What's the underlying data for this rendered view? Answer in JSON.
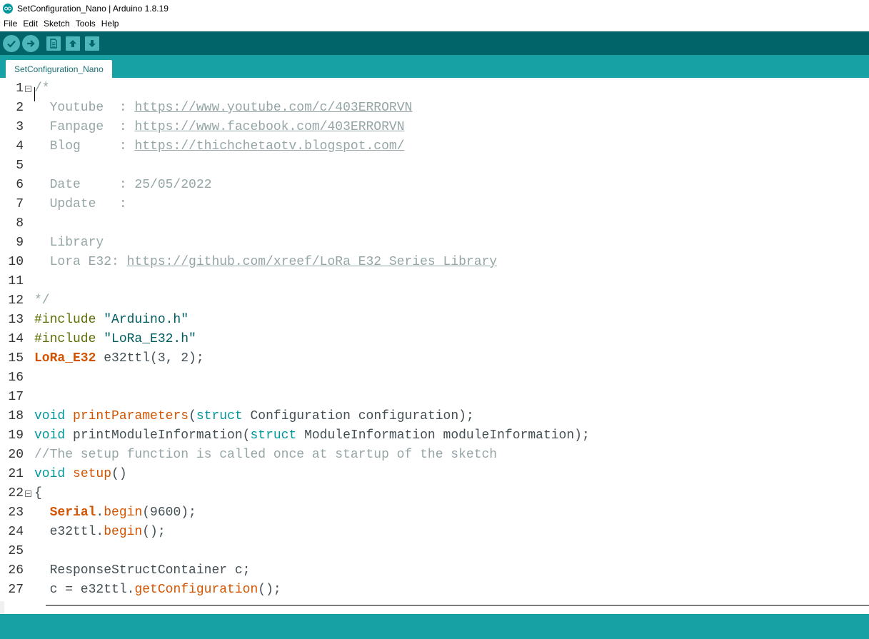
{
  "window": {
    "title": "SetConfiguration_Nano | Arduino 1.8.19"
  },
  "menu": [
    "File",
    "Edit",
    "Sketch",
    "Tools",
    "Help"
  ],
  "toolbar": {
    "verify": "verify-icon",
    "upload": "upload-icon",
    "new": "new-icon",
    "open": "open-icon",
    "save": "save-icon"
  },
  "tab": {
    "label": "SetConfiguration_Nano"
  },
  "colors": {
    "toolbar": "#006468",
    "tabstrip": "#17a1a5",
    "comment": "#95a5a6",
    "keyword_type": "#00979c",
    "function": "#d35400",
    "preprocessor": "#5e6d03"
  },
  "lines": [
    {
      "n": "1",
      "fold": true,
      "tokens": [
        [
          "comment",
          "/*"
        ]
      ]
    },
    {
      "n": "2",
      "tokens": [
        [
          "comment",
          "  Youtube  : "
        ],
        [
          "url",
          "https://www.youtube.com/c/403ERRORVN"
        ]
      ]
    },
    {
      "n": "3",
      "tokens": [
        [
          "comment",
          "  Fanpage  : "
        ],
        [
          "url",
          "https://www.facebook.com/403ERRORVN"
        ]
      ]
    },
    {
      "n": "4",
      "tokens": [
        [
          "comment",
          "  Blog     : "
        ],
        [
          "url",
          "https://thichchetaotv.blogspot.com/"
        ]
      ]
    },
    {
      "n": "5",
      "tokens": []
    },
    {
      "n": "6",
      "tokens": [
        [
          "comment",
          "  Date     : 25/05/2022"
        ]
      ]
    },
    {
      "n": "7",
      "tokens": [
        [
          "comment",
          "  Update   :"
        ]
      ]
    },
    {
      "n": "8",
      "tokens": []
    },
    {
      "n": "9",
      "tokens": [
        [
          "comment",
          "  Library"
        ]
      ]
    },
    {
      "n": "10",
      "tokens": [
        [
          "comment",
          "  Lora E32: "
        ],
        [
          "url",
          "https://github.com/xreef/LoRa_E32_Series_Library"
        ]
      ]
    },
    {
      "n": "11",
      "tokens": []
    },
    {
      "n": "12",
      "tokens": [
        [
          "comment",
          "*/"
        ]
      ]
    },
    {
      "n": "13",
      "tokens": [
        [
          "pre",
          "#include "
        ],
        [
          "str",
          "\"Arduino.h\""
        ]
      ]
    },
    {
      "n": "14",
      "tokens": [
        [
          "pre",
          "#include "
        ],
        [
          "str",
          "\"LoRa_E32.h\""
        ]
      ]
    },
    {
      "n": "15",
      "tokens": [
        [
          "cls",
          "LoRa_E32"
        ],
        [
          "plain",
          " e32ttl(3, 2);"
        ]
      ]
    },
    {
      "n": "16",
      "tokens": []
    },
    {
      "n": "17",
      "tokens": []
    },
    {
      "n": "18",
      "tokens": [
        [
          "type",
          "void"
        ],
        [
          "plain",
          " "
        ],
        [
          "fn",
          "printParameters"
        ],
        [
          "plain",
          "("
        ],
        [
          "type",
          "struct"
        ],
        [
          "plain",
          " Configuration configuration);"
        ]
      ]
    },
    {
      "n": "19",
      "tokens": [
        [
          "type",
          "void"
        ],
        [
          "plain",
          " printModuleInformation("
        ],
        [
          "type",
          "struct"
        ],
        [
          "plain",
          " ModuleInformation moduleInformation);"
        ]
      ]
    },
    {
      "n": "20",
      "tokens": [
        [
          "comment",
          "//The setup function is called once at startup of the sketch"
        ]
      ]
    },
    {
      "n": "21",
      "tokens": [
        [
          "type",
          "void"
        ],
        [
          "plain",
          " "
        ],
        [
          "fn",
          "setup"
        ],
        [
          "plain",
          "()"
        ]
      ]
    },
    {
      "n": "22",
      "fold": true,
      "tokens": [
        [
          "plain",
          "{"
        ]
      ]
    },
    {
      "n": "23",
      "tokens": [
        [
          "plain",
          "  "
        ],
        [
          "cls",
          "Serial"
        ],
        [
          "plain",
          "."
        ],
        [
          "fn",
          "begin"
        ],
        [
          "plain",
          "(9600);"
        ]
      ]
    },
    {
      "n": "24",
      "tokens": [
        [
          "plain",
          "  e32ttl."
        ],
        [
          "fn",
          "begin"
        ],
        [
          "plain",
          "();"
        ]
      ]
    },
    {
      "n": "25",
      "tokens": []
    },
    {
      "n": "26",
      "tokens": [
        [
          "plain",
          "  ResponseStructContainer c;"
        ]
      ]
    },
    {
      "n": "27",
      "tokens": [
        [
          "plain",
          "  c = e32ttl."
        ],
        [
          "fn",
          "getConfiguration"
        ],
        [
          "plain",
          "();"
        ]
      ]
    }
  ]
}
